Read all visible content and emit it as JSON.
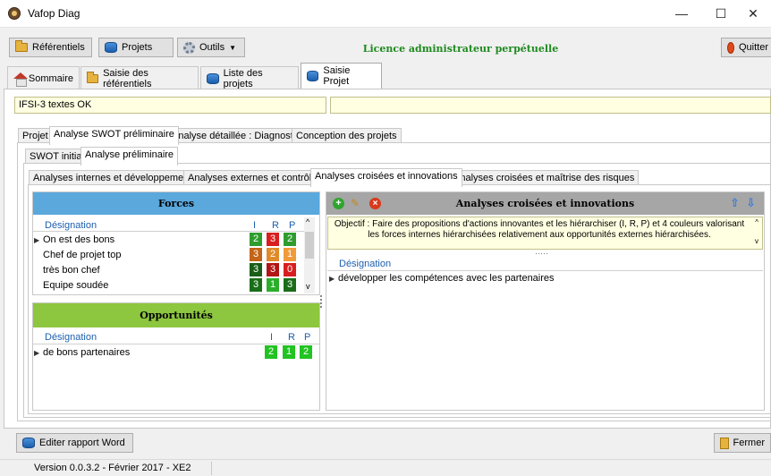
{
  "window": {
    "title": "Vafop Diag",
    "minimize": "—",
    "maximize": "☐",
    "close": "✕"
  },
  "toolbar": {
    "referentiels": "Référentiels",
    "projets": "Projets",
    "outils": "Outils",
    "outils_arrow": "▼",
    "licence": "Licence administrateur perpétuelle",
    "quitter": "Quitter"
  },
  "main_tabs": [
    "Sommaire",
    "Saisie des référentiels",
    "Liste des projets",
    "Saisie Projet"
  ],
  "project_name": "IFSI-3 textes OK",
  "project_field2": "",
  "tabs_level1": [
    "Projet",
    "Analyse SWOT préliminaire",
    "Analyse détaillée : Diagnostic",
    "Conception des projets"
  ],
  "tabs_level2": [
    "SWOT initial",
    "Analyse préliminaire"
  ],
  "tabs_level3": [
    "Analyses internes et développement",
    "Analyses externes et contrôle",
    "Analyses croisées et innovations",
    "Analyses croisées et maîtrise des risques"
  ],
  "forces": {
    "title": "Forces",
    "col_designation": "Désignation",
    "col_i": "I",
    "col_r": "R",
    "col_p": "P",
    "rows": [
      {
        "label": "On est  des bons",
        "i": "2",
        "r": "3",
        "p": "2",
        "ci": "#2e9d2e",
        "cr": "#d81e1e",
        "cp": "#2e9d2e"
      },
      {
        "label": "Chef de projet top",
        "i": "3",
        "r": "2",
        "p": "1",
        "ci": "#c46417",
        "cr": "#e08a2a",
        "cp": "#f09a3a"
      },
      {
        "label": "très bon chef",
        "i": "3",
        "r": "3",
        "p": "0",
        "ci": "#1a5e1a",
        "cr": "#b11515",
        "cp": "#d81e1e"
      },
      {
        "label": "Equipe soudée",
        "i": "3",
        "r": "1",
        "p": "3",
        "ci": "#1a6e1a",
        "cr": "#2aae2a",
        "cp": "#1a6e1a"
      }
    ]
  },
  "opportunites": {
    "title": "Opportunités",
    "col_designation": "Désignation",
    "col_i": "I",
    "col_r": "R",
    "col_p": "P",
    "rows": [
      {
        "label": "de bons partenaires",
        "i": "2",
        "r": "1",
        "p": "2",
        "ci": "#22c322",
        "cr": "#22c322",
        "cp": "#22c322"
      }
    ]
  },
  "croisees": {
    "title": "Analyses croisées et innovations",
    "objectif_label": "Objectif :",
    "objectif_text": "Faire des propositions d'actions innovantes et les hiérarchiser (I, R, P) et 4 couleurs valorisant les forces internes hiérarchisées relativement aux opportunités externes hiérarchisées.",
    "col_designation": "Désignation",
    "rows": [
      "développer les compétences avec les partenaires"
    ]
  },
  "bottom": {
    "editer": "Editer rapport Word",
    "fermer": "Fermer"
  },
  "status": "Version 0.0.3.2 - Février 2017 - XE2",
  "colors": {
    "forces_header": "#5aa8dc",
    "opportunites_header": "#8dc63f",
    "croisees_header": "#a6a6a6",
    "licence": "#1f8a1f"
  }
}
